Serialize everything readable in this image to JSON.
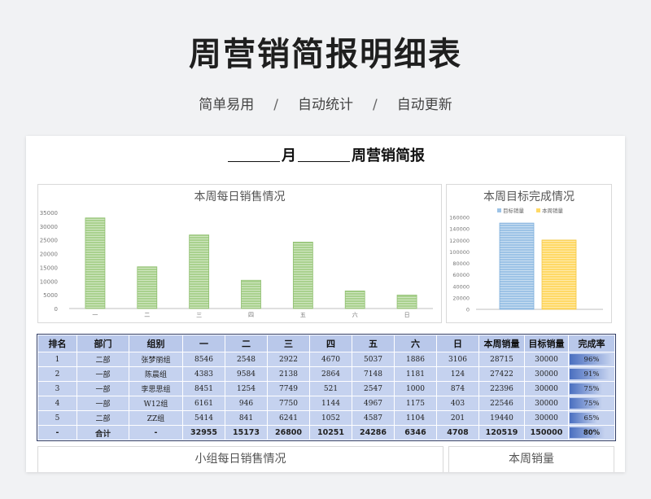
{
  "header": {
    "title": "周营销简报明细表",
    "sub_items": [
      "简单易用",
      "自动统计",
      "自动更新"
    ],
    "separator": "/"
  },
  "report": {
    "title_month": "月",
    "title_rest": "周营销简报"
  },
  "chart_data": [
    {
      "type": "bar",
      "title": "本周每日销售情况",
      "categories": [
        "一",
        "二",
        "三",
        "四",
        "五",
        "六",
        "日"
      ],
      "values": [
        33000,
        15200,
        26800,
        10300,
        24200,
        6400,
        4900
      ],
      "ylim": [
        0,
        35000
      ],
      "yticks": [
        "0",
        "5000",
        "10000",
        "15000",
        "20000",
        "25000",
        "30000",
        "35000"
      ],
      "color": "#a9d18e",
      "legend": "none"
    },
    {
      "type": "bar",
      "title": "本周目标完成情况",
      "categories": [
        ""
      ],
      "series": [
        {
          "name": "目标销量",
          "values": [
            150000
          ],
          "color": "#9dc3e6"
        },
        {
          "name": "本周销量",
          "values": [
            120519
          ],
          "color": "#ffd966"
        }
      ],
      "ylim": [
        0,
        160000
      ],
      "yticks": [
        "0",
        "20000",
        "40000",
        "60000",
        "80000",
        "100000",
        "120000",
        "140000",
        "160000"
      ],
      "legend": "top"
    }
  ],
  "table": {
    "headers": [
      "排名",
      "部门",
      "组别",
      "一",
      "二",
      "三",
      "四",
      "五",
      "六",
      "日",
      "本周销量",
      "目标销量",
      "完成率"
    ],
    "rows": [
      {
        "cells": [
          "1",
          "二部",
          "张梦丽组",
          "8546",
          "2548",
          "2922",
          "4670",
          "5037",
          "1886",
          "3106",
          "28715",
          "30000",
          "96%"
        ],
        "rate": 0.96
      },
      {
        "cells": [
          "2",
          "一部",
          "陈晨组",
          "4383",
          "9584",
          "2138",
          "2864",
          "7148",
          "1181",
          "124",
          "27422",
          "30000",
          "91%"
        ],
        "rate": 0.91
      },
      {
        "cells": [
          "3",
          "一部",
          "李思思组",
          "8451",
          "1254",
          "7749",
          "521",
          "2547",
          "1000",
          "874",
          "22396",
          "30000",
          "75%"
        ],
        "rate": 0.75
      },
      {
        "cells": [
          "4",
          "一部",
          "W12组",
          "6161",
          "946",
          "7750",
          "1144",
          "4967",
          "1175",
          "403",
          "22546",
          "30000",
          "75%"
        ],
        "rate": 0.75
      },
      {
        "cells": [
          "5",
          "二部",
          "ZZ组",
          "5414",
          "841",
          "6241",
          "1052",
          "4587",
          "1104",
          "201",
          "19440",
          "30000",
          "65%"
        ],
        "rate": 0.65
      }
    ],
    "total": {
      "cells": [
        "-",
        "合计",
        "-",
        "32955",
        "15173",
        "26800",
        "10251",
        "24286",
        "6346",
        "4708",
        "120519",
        "150000",
        "80%"
      ],
      "rate": 0.8
    }
  },
  "bottom_charts": {
    "left_title": "小组每日销售情况",
    "right_title": "本周销量"
  }
}
